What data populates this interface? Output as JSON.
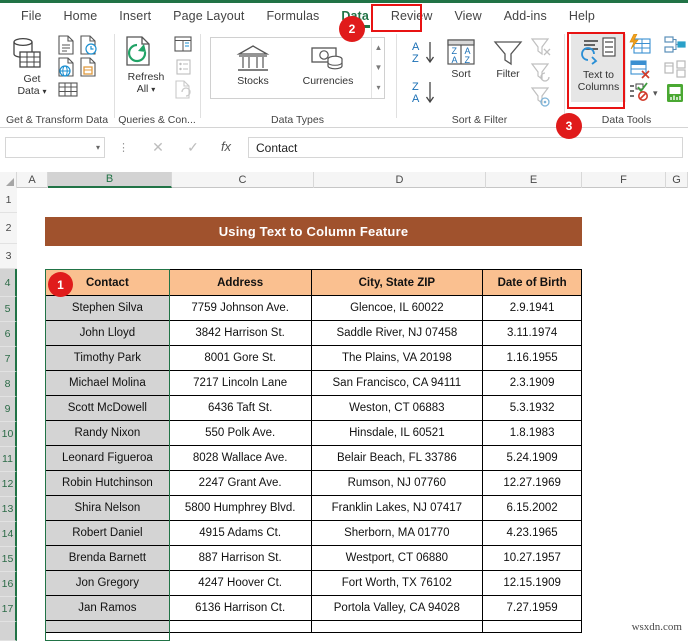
{
  "ribbon": {
    "tabs": [
      {
        "label": "File",
        "active": false
      },
      {
        "label": "Home",
        "active": false
      },
      {
        "label": "Insert",
        "active": false
      },
      {
        "label": "Page Layout",
        "active": false
      },
      {
        "label": "Formulas",
        "active": false
      },
      {
        "label": "Data",
        "active": true
      },
      {
        "label": "Review",
        "active": false
      },
      {
        "label": "View",
        "active": false
      },
      {
        "label": "Add-ins",
        "active": false
      },
      {
        "label": "Help",
        "active": false
      }
    ],
    "groups": [
      {
        "name": "Get & Transform Data",
        "label": "Get & Transform Data"
      },
      {
        "name": "Queries & Connections",
        "label": "Queries & Con..."
      },
      {
        "name": "Data Types",
        "label": "Data Types"
      },
      {
        "name": "Sort & Filter",
        "label": "Sort & Filter"
      },
      {
        "name": "Data Tools",
        "label": "Data Tools"
      }
    ],
    "buttons": {
      "get_data": "Get\nData",
      "get_data_line1": "Get",
      "get_data_line2": "Data",
      "refresh_all_line1": "Refresh",
      "refresh_all_line2": "All",
      "stocks": "Stocks",
      "currencies": "Currencies",
      "sort": "Sort",
      "filter": "Filter",
      "text_to_columns_line1": "Text to",
      "text_to_columns_line2": "Columns"
    }
  },
  "annotations": [
    {
      "number": "1",
      "target": "contact-header-cell"
    },
    {
      "number": "2",
      "target": "data-tab"
    },
    {
      "number": "3",
      "target": "text-to-columns-button"
    }
  ],
  "formula_bar": {
    "name_box_value": "",
    "cancel_icon": "✕",
    "confirm_icon": "✓",
    "fx_label": "fx",
    "formula_value": "Contact"
  },
  "grid": {
    "columns": [
      "A",
      "B",
      "C",
      "D",
      "E",
      "F",
      "G"
    ],
    "selected_column": "B",
    "rows": [
      "1",
      "2",
      "3",
      "4",
      "5",
      "6",
      "7",
      "8",
      "9",
      "10",
      "11",
      "12",
      "13",
      "14",
      "15",
      "16",
      "17"
    ],
    "selected_rows": [
      "4",
      "5",
      "6",
      "7",
      "8",
      "9",
      "10",
      "11",
      "12",
      "13",
      "14",
      "15",
      "16",
      "17"
    ]
  },
  "sheet": {
    "title": "Using Text to Column Feature",
    "table": {
      "headers": [
        "Contact",
        "Address",
        "City, State ZIP",
        "Date of Birth"
      ],
      "rows": [
        [
          "Stephen Silva",
          "7759 Johnson Ave.",
          "Glencoe, IL   60022",
          "2.9.1941"
        ],
        [
          "John Lloyd",
          "3842 Harrison St.",
          "Saddle River, NJ 07458",
          "3.11.1974"
        ],
        [
          "Timothy Park",
          "8001 Gore St.",
          "The Plains, VA   20198",
          "1.16.1955"
        ],
        [
          "Michael Molina",
          "7217 Lincoln Lane",
          "San Francisco, CA   94111",
          "2.3.1909"
        ],
        [
          "Scott McDowell",
          "6436 Taft St.",
          "Weston, CT   06883",
          "5.3.1932"
        ],
        [
          "Randy Nixon",
          "550 Polk Ave.",
          "Hinsdale, IL   60521",
          "1.8.1983"
        ],
        [
          "Leonard Figueroa",
          "8028 Wallace Ave.",
          "Belair Beach, FL   33786",
          "5.24.1909"
        ],
        [
          "Robin Hutchinson",
          "2247 Grant Ave.",
          "Rumson, NJ   07760",
          "12.27.1969"
        ],
        [
          "Shira Nelson",
          "5800 Humphrey Blvd.",
          "Franklin Lakes, NJ   07417",
          "6.15.2002"
        ],
        [
          "Robert Daniel",
          "4915 Adams Ct.",
          "Sherborn, MA   01770",
          "4.23.1965"
        ],
        [
          "Brenda Barnett",
          "887 Harrison St.",
          "Westport, CT   06880",
          "10.27.1957"
        ],
        [
          "Jon Gregory",
          "4247 Hoover Ct.",
          "Fort Worth, TX   76102",
          "12.15.1909"
        ],
        [
          "Jan Ramos",
          "6136 Harrison Ct.",
          "Portola Valley, CA   94028",
          "7.27.1959"
        ]
      ]
    }
  },
  "watermark": "wsxdn.com",
  "colors": {
    "excel_green": "#217346",
    "title_fill": "#a0522d",
    "header_fill": "#fac090",
    "name_col_fill": "#d4d4d4",
    "annotation_red": "#e01b1b"
  }
}
